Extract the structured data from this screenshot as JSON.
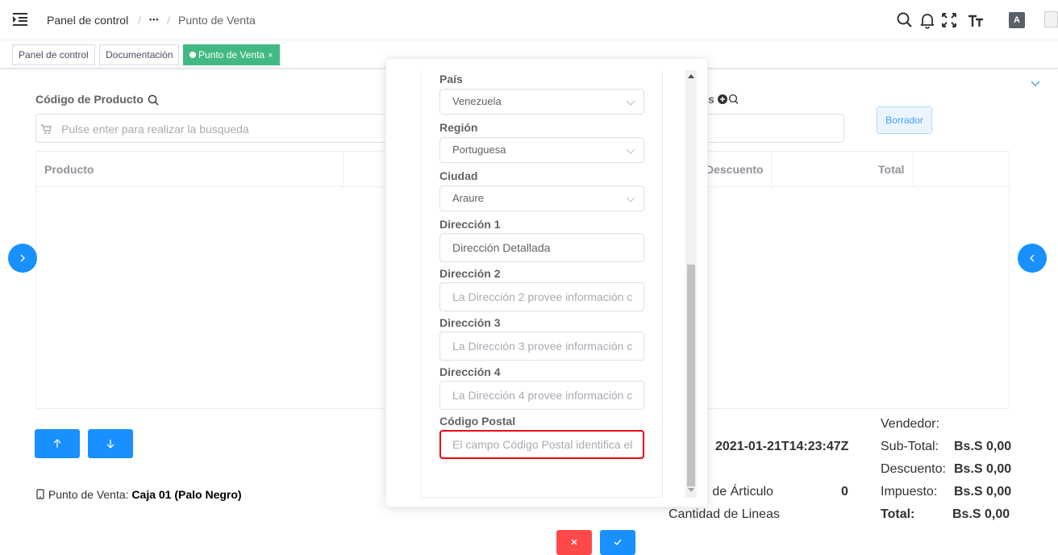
{
  "navbar": {
    "breadcrumb": {
      "home": "Panel de control",
      "sep": "/",
      "ellipsis": "•••",
      "current": "Punto de Venta"
    },
    "icons": [
      "hamburger-icon",
      "search-icon",
      "bell-icon",
      "fullscreen-icon",
      "text-size-icon",
      "translate-icon",
      "avatar"
    ],
    "translate_label": "A"
  },
  "tags": [
    {
      "label": "Panel de control",
      "active": false
    },
    {
      "label": "Documentación",
      "active": false
    },
    {
      "label": "Punto de Venta",
      "active": true,
      "close": "×"
    }
  ],
  "main": {
    "product_code_label": "Código de Producto",
    "search_placeholder": "Pulse enter para realizar la busqueda",
    "right_label_fragment": "s",
    "borrador_label": "Borrador",
    "table_headers": {
      "product": "Producto",
      "discount": "Descuento",
      "total": "Total"
    },
    "pos_label": "Punto de Venta:",
    "pos_value": "Caja 01 (Palo Negro)",
    "timestamp": "2021-01-21T14:23:47Z",
    "article_qty_label": "d de Árticulo",
    "article_qty_value": "0",
    "lines_qty_label": "Cantidad de Lineas",
    "summary": {
      "seller_label": "Vendedor:",
      "subtotal_label": "Sub-Total:",
      "subtotal_value": "Bs.S 0,00",
      "discount_label": "Descuento:",
      "discount_value": "Bs.S 0,00",
      "tax_label": "Impuesto:",
      "tax_value": "Bs.S 0,00",
      "total_label": "Total:",
      "total_value": "Bs.S 0,00"
    }
  },
  "form": {
    "country_label": "País",
    "country_value": "Venezuela",
    "region_label": "Región",
    "region_value": "Portuguesa",
    "city_label": "Ciudad",
    "city_value": "Araure",
    "address1_label": "Dirección 1",
    "address1_value": "Dirección Detallada",
    "address2_label": "Dirección 2",
    "address2_placeholder": "La Dirección 2 provee información c",
    "address3_label": "Dirección 3",
    "address3_placeholder": "La Dirección 3 provee información c",
    "address4_label": "Dirección 4",
    "address4_placeholder": "La Dirección 4 provee información c",
    "postal_label": "Código Postal",
    "postal_placeholder": "El campo Código Postal identifica el",
    "cancel_icon": "close-icon",
    "confirm_icon": "check-icon"
  },
  "colors": {
    "primary": "#1890ff",
    "danger": "#ff4949",
    "tag_active": "#42b983",
    "error_border": "#e60012"
  }
}
